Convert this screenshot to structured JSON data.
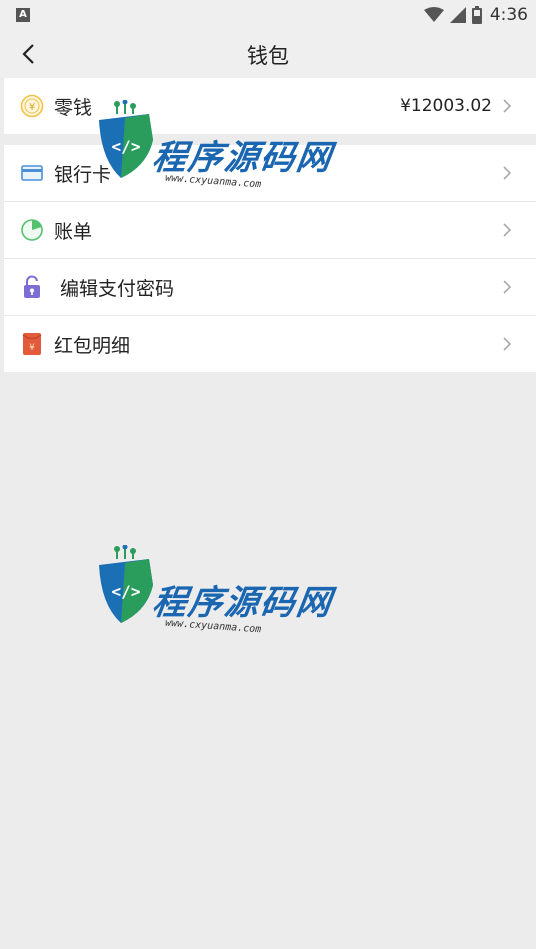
{
  "status_bar": {
    "time": "4:36",
    "notification_badge": "A"
  },
  "app_bar": {
    "title": "钱包"
  },
  "wallet": {
    "change": {
      "label": "零钱",
      "amount": "¥12003.02"
    }
  },
  "menu": {
    "items": [
      {
        "label": "银行卡",
        "icon": "bank-card-icon"
      },
      {
        "label": "账单",
        "icon": "pie-chart-icon"
      },
      {
        "label": "编辑支付密码",
        "icon": "lock-icon"
      },
      {
        "label": "红包明细",
        "icon": "red-envelope-icon"
      }
    ]
  },
  "watermark": {
    "brand": "程序源码网",
    "url": "www.cxyuanma.com"
  },
  "colors": {
    "background": "#ececec",
    "card": "#ffffff",
    "coin": "#f0c24b",
    "card_icon": "#4a90d9",
    "pie": "#55c06e",
    "lock": "#7b6fd6",
    "envelope": "#e25a3b"
  }
}
